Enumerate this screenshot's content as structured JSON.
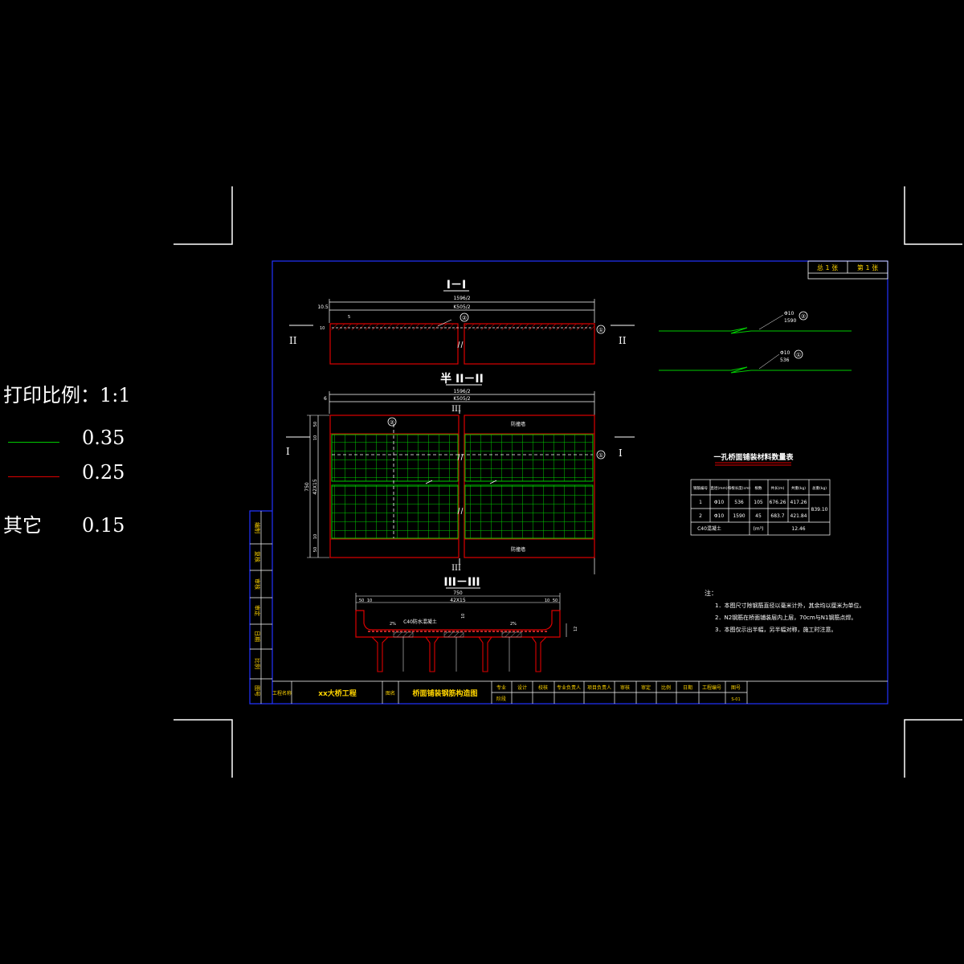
{
  "legend": {
    "print_scale": "打印比例：1:1",
    "green_weight": "0.35",
    "red_weight": "0.25",
    "other_label": "其它",
    "other_weight": "0.15",
    "green_color": "#00cc00",
    "red_color": "#dd0000"
  },
  "sheet": {
    "total_sheets": "总 1 张",
    "sheet_no": "第 1 张"
  },
  "section_1": {
    "title": "I－I",
    "dim_top": "1596/2",
    "dim_second": "K505/2",
    "dim_left": "10.5",
    "dim_small": "5",
    "dim_side": "10",
    "callout_2": "②",
    "callout_1": "①",
    "mark_left": "II",
    "mark_right": "II"
  },
  "section_2": {
    "title": "半 II－II",
    "dim_top": "1596/2",
    "dim_second": "K505/2",
    "dim_left": "6",
    "mark_iii_top": "III",
    "mark_iii_bottom": "III",
    "mark_i_left": "I",
    "mark_i_right": "I",
    "callout_2": "②",
    "callout_1": "①",
    "label_top_right": "防撞墙",
    "label_bottom_right": "防撞墙",
    "dim_v_total": "750",
    "dim_v_inner": "42X15",
    "dim_v_a": "50",
    "dim_v_b": "10",
    "dim_v_c": "10",
    "dim_v_d": "50"
  },
  "section_3": {
    "title": "III－III",
    "dim_total": "750",
    "dim_inner": "42X15",
    "dim_left_a": "50",
    "dim_left_b": "10",
    "dim_right_a": "10",
    "dim_right_b": "50",
    "label_concrete": "C40防水混凝土",
    "slope_left": "2%",
    "slope_right": "2%",
    "dim_depth": "12",
    "dim_thk": "10"
  },
  "rebar_details": {
    "bar2_dia": "Φ10",
    "bar2_len": "1590",
    "bar2_no": "②",
    "bar1_dia": "Φ10",
    "bar1_len": "536",
    "bar1_no": "①"
  },
  "material_table": {
    "title": "一孔桥面铺装材料数量表",
    "headers": [
      "钢筋编号",
      "直径(mm)",
      "每根长度(cm)",
      "根数",
      "共长(m)",
      "共重(kg)",
      "总重(kg)"
    ],
    "rows": [
      [
        "1",
        "Φ10",
        "536",
        "105",
        "676.26",
        "417.26"
      ],
      [
        "2",
        "Φ10",
        "1590",
        "45",
        "683.7",
        "421.84"
      ]
    ],
    "total_weight": "839.10",
    "concrete_label": "C40混凝土",
    "concrete_unit": "(m³)",
    "concrete_value": "12.46"
  },
  "notes": {
    "title": "注：",
    "items": [
      "1．本图尺寸除钢筋直径以毫米计外，其余均以厘米为单位。",
      "2．N2钢筋在桥面铺装层内上层，70cm与N1钢筋点焊。",
      "3．本图仅示出半幅，另半幅对称，施工时注意。"
    ]
  },
  "left_strip": [
    "编制",
    "复核",
    "审核",
    "审定",
    "日期",
    "比例",
    "图号"
  ],
  "title_block": {
    "project_label": "工程名称",
    "project_name": "xx大桥工程",
    "drawing_label": "图名",
    "drawing_name": "桥面铺装钢筋构造图",
    "cells": [
      "专业",
      "设计",
      "校核",
      "专业负责人",
      "项目负责人",
      "审核",
      "审定",
      "比例",
      "日期",
      "工程编号",
      "图号"
    ],
    "sub_cells": [
      "阶段"
    ],
    "drawing_no": "S-01"
  }
}
